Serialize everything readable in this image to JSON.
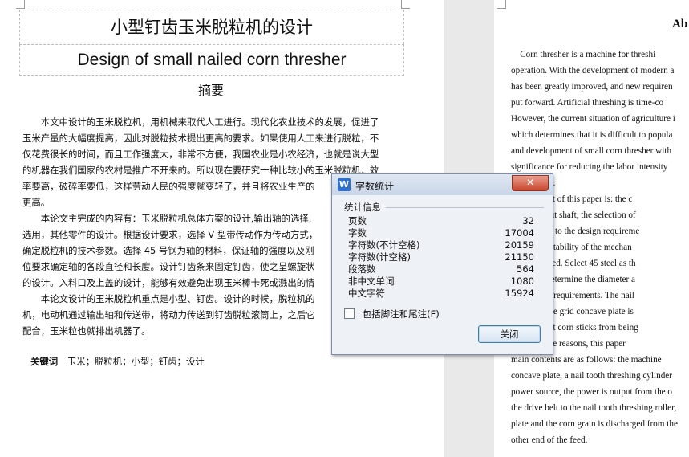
{
  "left_page": {
    "title_cn": "小型钉齿玉米脱粒机的设计",
    "title_en": "Design of small nailed corn thresher",
    "abstract_heading": "摘要",
    "body_lines": [
      "　　本文中设计的玉米脱粒机，用机械来取代人工进行。现代化农业技术的发展，促进了",
      "玉米产量的大幅度提高，因此对脱粒技术提出更高的要求。如果使用人工来进行脱粒，不",
      "仅花费很长的时间，而且工作强度大，非常不方便，我国农业是小农经济，也就是说大型",
      "的机器在我们国家的农村是推广不开来的。所以现在要研究一种比较小的玉米脱粒机，效",
      "率要高，破碎率要低，这样劳动人民的强度就变轻了，并且将农业生产的",
      "更高。",
      "　　本论文主完成的内容有：玉米脱粒机总体方案的设计,输出轴的选择,",
      "选用，其他零件的设计。根据设计要求，选择 V 型带传动作为传动方式，",
      "确定脱粒机的技术参数。选择 45 号钢为轴的材料，保证轴的强度以及刚",
      "位要求确定轴的各段直径和长度。设计钉齿条来固定钉齿，使之呈螺旋状",
      "的设计。入料口及上盖的设计，能够有效避免出现玉米棒卡死或溅出的情",
      "　　本论文设计的玉米脱粒机重点是小型、钉齿。设计的时候，脱粒机的",
      "机，电动机通过输出轴和传送带，将动力传送到钉齿脱粒滚筒上，之后它",
      "配合，玉米粒也就排出机器了。"
    ],
    "keywords_label": "关键词",
    "keywords": "玉米；脱粒机；小型；钉齿；设计"
  },
  "right_page": {
    "abstract_title": "Ab",
    "body_lines": [
      "　Corn thresher is a machine for threshi",
      "operation. With the development of modern a",
      "has been greatly improved, and new requiren",
      "put forward. Artificial threshing is time-co",
      "However, the current situation of agriculture i",
      "which determines that it is difficult to popula",
      "and development of small corn thresher with",
      "significance for reducing the labor intensity",
      "l operations.",
      "nain content of this paper is: the c",
      "of the output shaft, the selection of",
      ". According to the design requireme",
      "ensure the stability of the mechan",
      "re determined. Select 45 steel as th",
      "the shaft; determine the diameter a",
      "positioning requirements. The nail",
      "design of the grid concave plate is",
      "vely prevent corn sticks from being",
      "on the above reasons, this paper",
      "main contents are as follows: the machine",
      "concave plate, a nail tooth threshing cylinder",
      "power source, the power is output from the o",
      "the drive belt to the nail tooth threshing roller,",
      "plate and the corn grain is discharged from the",
      "other end of the feed."
    ]
  },
  "dialog": {
    "title": "字数统计",
    "app_icon": "W",
    "close_x": "✕",
    "group_label": "统计信息",
    "stats": [
      {
        "label": "页数",
        "value": "32"
      },
      {
        "label": "字数",
        "value": "17004"
      },
      {
        "label": "字符数(不计空格)",
        "value": "20159"
      },
      {
        "label": "字符数(计空格)",
        "value": "21150"
      },
      {
        "label": "段落数",
        "value": "564"
      },
      {
        "label": "非中文单词",
        "value": "1080"
      },
      {
        "label": "中文字符",
        "value": "15924"
      }
    ],
    "checkbox_label": "包括脚注和尾注(F)",
    "checkbox_checked": false,
    "close_button": "关闭"
  }
}
